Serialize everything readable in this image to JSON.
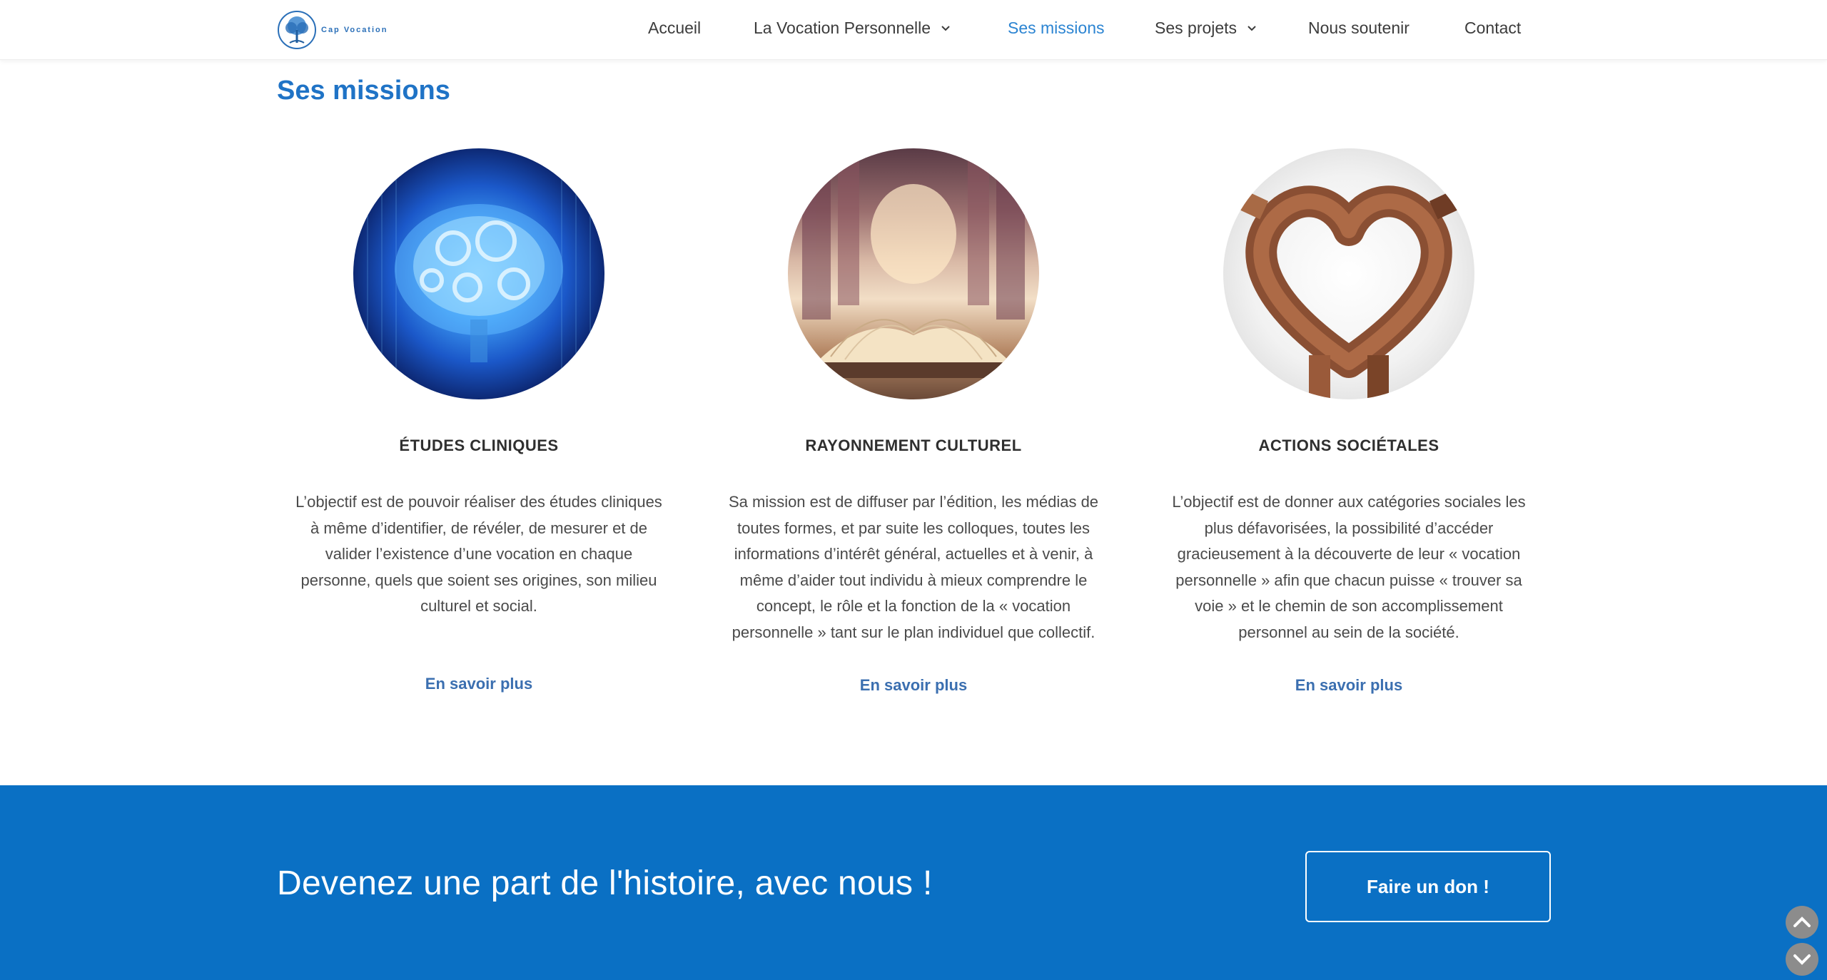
{
  "header": {
    "logo_text": "Cap Vocation",
    "nav": [
      {
        "label": "Accueil",
        "dropdown": false,
        "active": false
      },
      {
        "label": "La Vocation Personnelle",
        "dropdown": true,
        "active": false
      },
      {
        "label": "Ses missions",
        "dropdown": false,
        "active": true
      },
      {
        "label": "Ses projets",
        "dropdown": true,
        "active": false
      },
      {
        "label": "Nous soutenir",
        "dropdown": false,
        "active": false
      },
      {
        "label": "Contact",
        "dropdown": false,
        "active": false
      }
    ]
  },
  "page": {
    "title": "Ses missions"
  },
  "missions": [
    {
      "image": "brain-gears-image",
      "title": "ÉTUDES CLINIQUES",
      "lines": [
        "L’objectif est de pouvoir réaliser des études cliniques",
        "à même d’identifier, de révéler, de mesurer et de",
        "valider l’existence d’une vocation en chaque",
        "personne, quels que soient ses origines, son milieu",
        "culturel et social."
      ],
      "link": "En savoir plus"
    },
    {
      "image": "open-book-library-image",
      "title": "RAYONNEMENT CULTUREL",
      "lines": [
        "Sa mission est de diffuser par l’édition, les médias de",
        "toutes formes, et par suite les colloques, toutes les",
        "informations d’intérêt général, actuelles et à venir, à",
        "même d’aider tout individu à mieux comprendre le",
        "concept, le rôle et la fonction de la « vocation",
        "personnelle » tant sur le plan individuel que collectif."
      ],
      "link": "En savoir plus"
    },
    {
      "image": "hands-heart-image",
      "title": "ACTIONS SOCIÉTALES",
      "lines": [
        "L’objectif est de donner aux catégories sociales les",
        "plus défavorisées, la possibilité d’accéder",
        "gracieusement à la découverte de leur « vocation",
        "personnelle » afin que chacun puisse « trouver sa",
        "voie » et le chemin de son accomplissement",
        "personnel au sein de la société."
      ],
      "link": "En savoir plus"
    }
  ],
  "banner": {
    "text": "Devenez une part de l'histoire, avec nous !",
    "button": "Faire un don !",
    "color": "#0a70c4"
  },
  "colors": {
    "accent": "#1f73c6",
    "nav_active": "#2b84d2",
    "link": "#3b6fb0"
  }
}
